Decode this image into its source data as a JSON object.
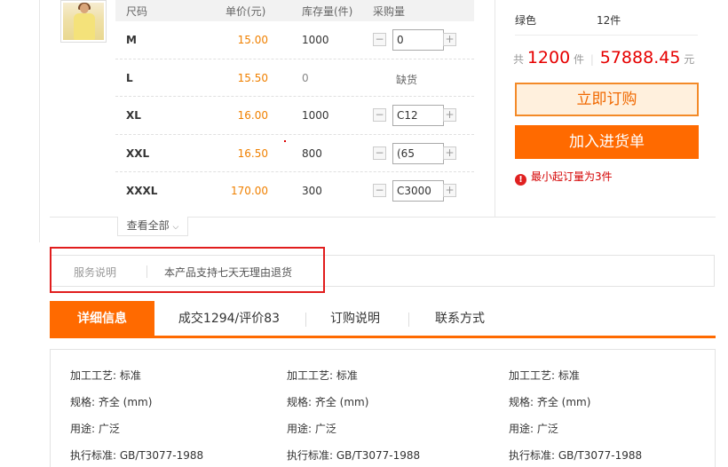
{
  "sku_table": {
    "headers": {
      "size": "尺码",
      "price": "单价(元)",
      "stock": "库存量(件)",
      "qty": "采购量"
    },
    "rows": [
      {
        "size": "M",
        "price": "15.00",
        "stock": "1000",
        "qty": "0",
        "status": ""
      },
      {
        "size": "L",
        "price": "15.50",
        "stock": "0",
        "qty": "",
        "status": "缺货"
      },
      {
        "size": "XL",
        "price": "16.00",
        "stock": "1000",
        "qty": "C12",
        "status": ""
      },
      {
        "size": "XXL",
        "price": "16.50",
        "stock": "800",
        "qty": "(65",
        "status": ""
      },
      {
        "size": "XXXL",
        "price": "170.00",
        "stock": "300",
        "qty": "C3000",
        "status": ""
      }
    ],
    "stepper": {
      "minus": "−",
      "plus": "+"
    },
    "view_all": "查看全部"
  },
  "summary": {
    "color_label": "绿色",
    "color_qty": "12件",
    "total_prefix": "共",
    "total_count": "1200",
    "total_unit": "件",
    "total_amount": "57888.45",
    "amount_unit": "元",
    "order_button": "立即订购",
    "cart_button": "加入进货单",
    "min_order_notice": "最小起订量为3件"
  },
  "service": {
    "label": "服务说明",
    "text": "本产品支持七天无理由退货"
  },
  "tabs": [
    {
      "label": "详细信息",
      "active": true
    },
    {
      "label": "成交1294/评价83",
      "active": false
    },
    {
      "label": "订购说明",
      "active": false
    },
    {
      "label": "联系方式",
      "active": false
    }
  ],
  "details": {
    "columns": [
      [
        "加工工艺: 标准",
        "规格: 齐全 (mm)",
        "用途: 广泛",
        "执行标准: GB/T3077-1988"
      ],
      [
        "加工工艺: 标准",
        "规格: 齐全 (mm)",
        "用途: 广泛",
        "执行标准: GB/T3077-1988"
      ],
      [
        "加工工艺: 标准",
        "规格: 齐全 (mm)",
        "用途: 广泛",
        "执行标准: GB/T3077-1988"
      ]
    ]
  },
  "colors": {
    "accent": "#ff6a00",
    "price": "#f08000",
    "alert": "#e60000"
  }
}
